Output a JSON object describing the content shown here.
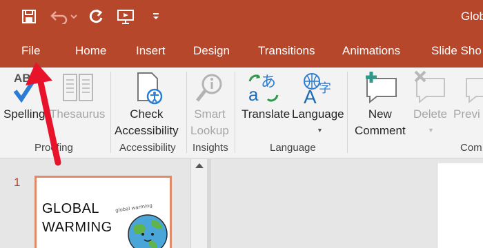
{
  "app": {
    "title": "Glob"
  },
  "qat": {
    "save_icon": "save-icon",
    "undo_icon": "undo-icon",
    "redo_icon": "repeat-icon",
    "present_icon": "start-from-beginning-icon",
    "customize_icon": "customize-qat-icon"
  },
  "tabs": [
    "File",
    "Home",
    "Insert",
    "Design",
    "Transitions",
    "Animations",
    "Slide Sho"
  ],
  "ribbon": {
    "spelling": "Spelling",
    "thesaurus": "Thesaurus",
    "proofing_abc": "ABC",
    "proofing_group": "Proofing",
    "check_accessibility": [
      "Check",
      "Accessibility"
    ],
    "accessibility_group": "Accessibility",
    "smart_lookup": [
      "Smart",
      "Lookup"
    ],
    "insights_group": "Insights",
    "translate": "Translate",
    "language": "Language",
    "language_group": "Language",
    "new_comment": [
      "New",
      "Comment"
    ],
    "delete": "Delete",
    "previous": "Previ",
    "comments_group": "Com"
  },
  "slides": {
    "number": "1",
    "thumbnail_title": [
      "GLOBAL",
      "WARMING"
    ],
    "thumbnail_caption": "global warming"
  },
  "colors": {
    "accent": "#b7472a",
    "arrow": "#e8132b"
  }
}
